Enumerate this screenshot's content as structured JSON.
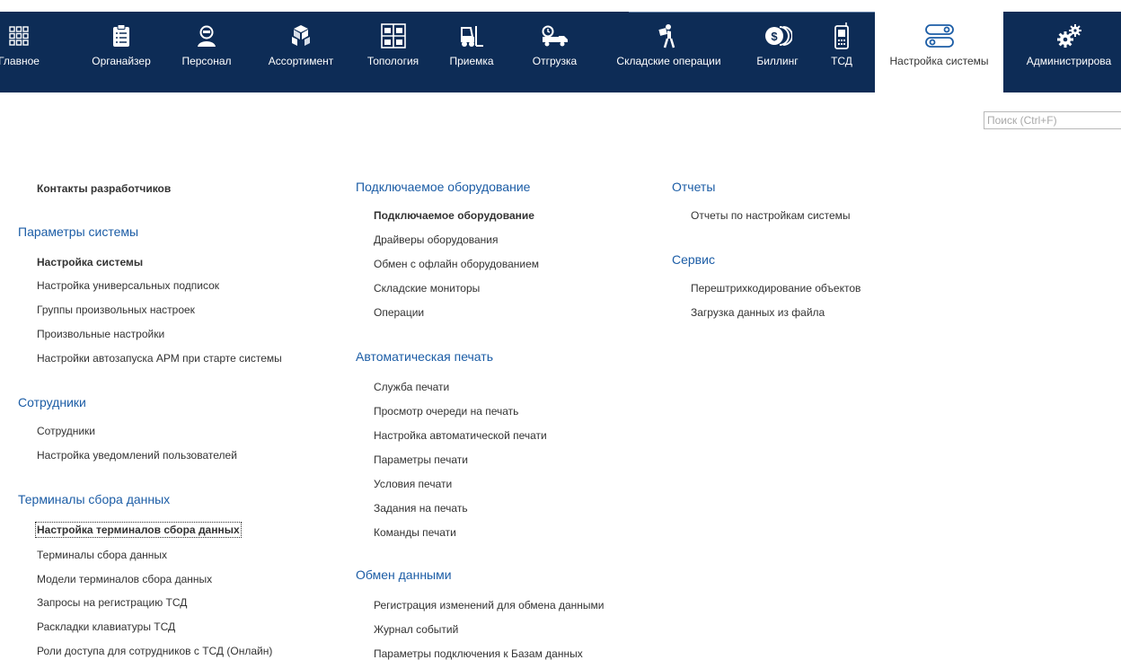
{
  "nav": {
    "items": [
      {
        "label": "Главное",
        "icon": "grid-icon"
      },
      {
        "label": "Органайзер",
        "icon": "clipboard-icon"
      },
      {
        "label": "Персонал",
        "icon": "staff-icon"
      },
      {
        "label": "Ассортимент",
        "icon": "boxes-icon"
      },
      {
        "label": "Топология",
        "icon": "shelves-icon"
      },
      {
        "label": "Приемка",
        "icon": "forklift-icon"
      },
      {
        "label": "Отгрузка",
        "icon": "truck-icon"
      },
      {
        "label": "Складские операции",
        "icon": "porter-icon"
      },
      {
        "label": "Биллинг",
        "icon": "coins-icon"
      },
      {
        "label": "ТСД",
        "icon": "handheld-icon"
      },
      {
        "label": "Настройка системы",
        "icon": "toggles-icon",
        "active": true
      },
      {
        "label": "Администрирова",
        "icon": "gears-icon"
      }
    ]
  },
  "search": {
    "placeholder": "Поиск (Ctrl+F)"
  },
  "col1": {
    "contacts": "Контакты разработчиков",
    "system_params": {
      "title": "Параметры системы",
      "items": [
        "Настройка системы",
        "Настройка универсальных подписок",
        "Группы произвольных настроек",
        "Произвольные настройки",
        "Настройки автозапуска АРМ при старте системы"
      ]
    },
    "employees": {
      "title": "Сотрудники",
      "items": [
        "Сотрудники",
        "Настройка уведомлений пользователей"
      ]
    },
    "terminals": {
      "title": "Терминалы сбора данных",
      "items": [
        "Настройка терминалов сбора данных",
        "Терминалы сбора данных",
        "Модели терминалов сбора данных",
        "Запросы на регистрацию ТСД",
        "Раскладки клавиатуры ТСД",
        "Роли доступа для сотрудников с ТСД (Онлайн)"
      ]
    }
  },
  "col2": {
    "equipment": {
      "title": "Подключаемое оборудование",
      "items": [
        "Подключаемое оборудование",
        "Драйверы оборудования",
        "Обмен с офлайн оборудованием",
        "Складские мониторы",
        "Операции"
      ]
    },
    "autoprint": {
      "title": "Автоматическая печать",
      "items": [
        "Служба печати",
        "Просмотр очереди на печать",
        "Настройка автоматической печати",
        "Параметры печати",
        "Условия печати",
        "Задания на печать",
        "Команды печати"
      ]
    },
    "exchange": {
      "title": "Обмен данными",
      "items": [
        "Регистрация изменений для обмена данными",
        "Журнал событий",
        "Параметры подключения к Базам данных"
      ]
    }
  },
  "col3": {
    "reports": {
      "title": "Отчеты",
      "items": [
        "Отчеты по настройкам системы"
      ]
    },
    "service": {
      "title": "Сервис",
      "items": [
        "Перештрихкодирование объектов",
        "Загрузка данных из файла"
      ]
    }
  },
  "colors": {
    "nav_bg": "#0d2c56",
    "section_title": "#1c5da6",
    "link": "#333333"
  }
}
